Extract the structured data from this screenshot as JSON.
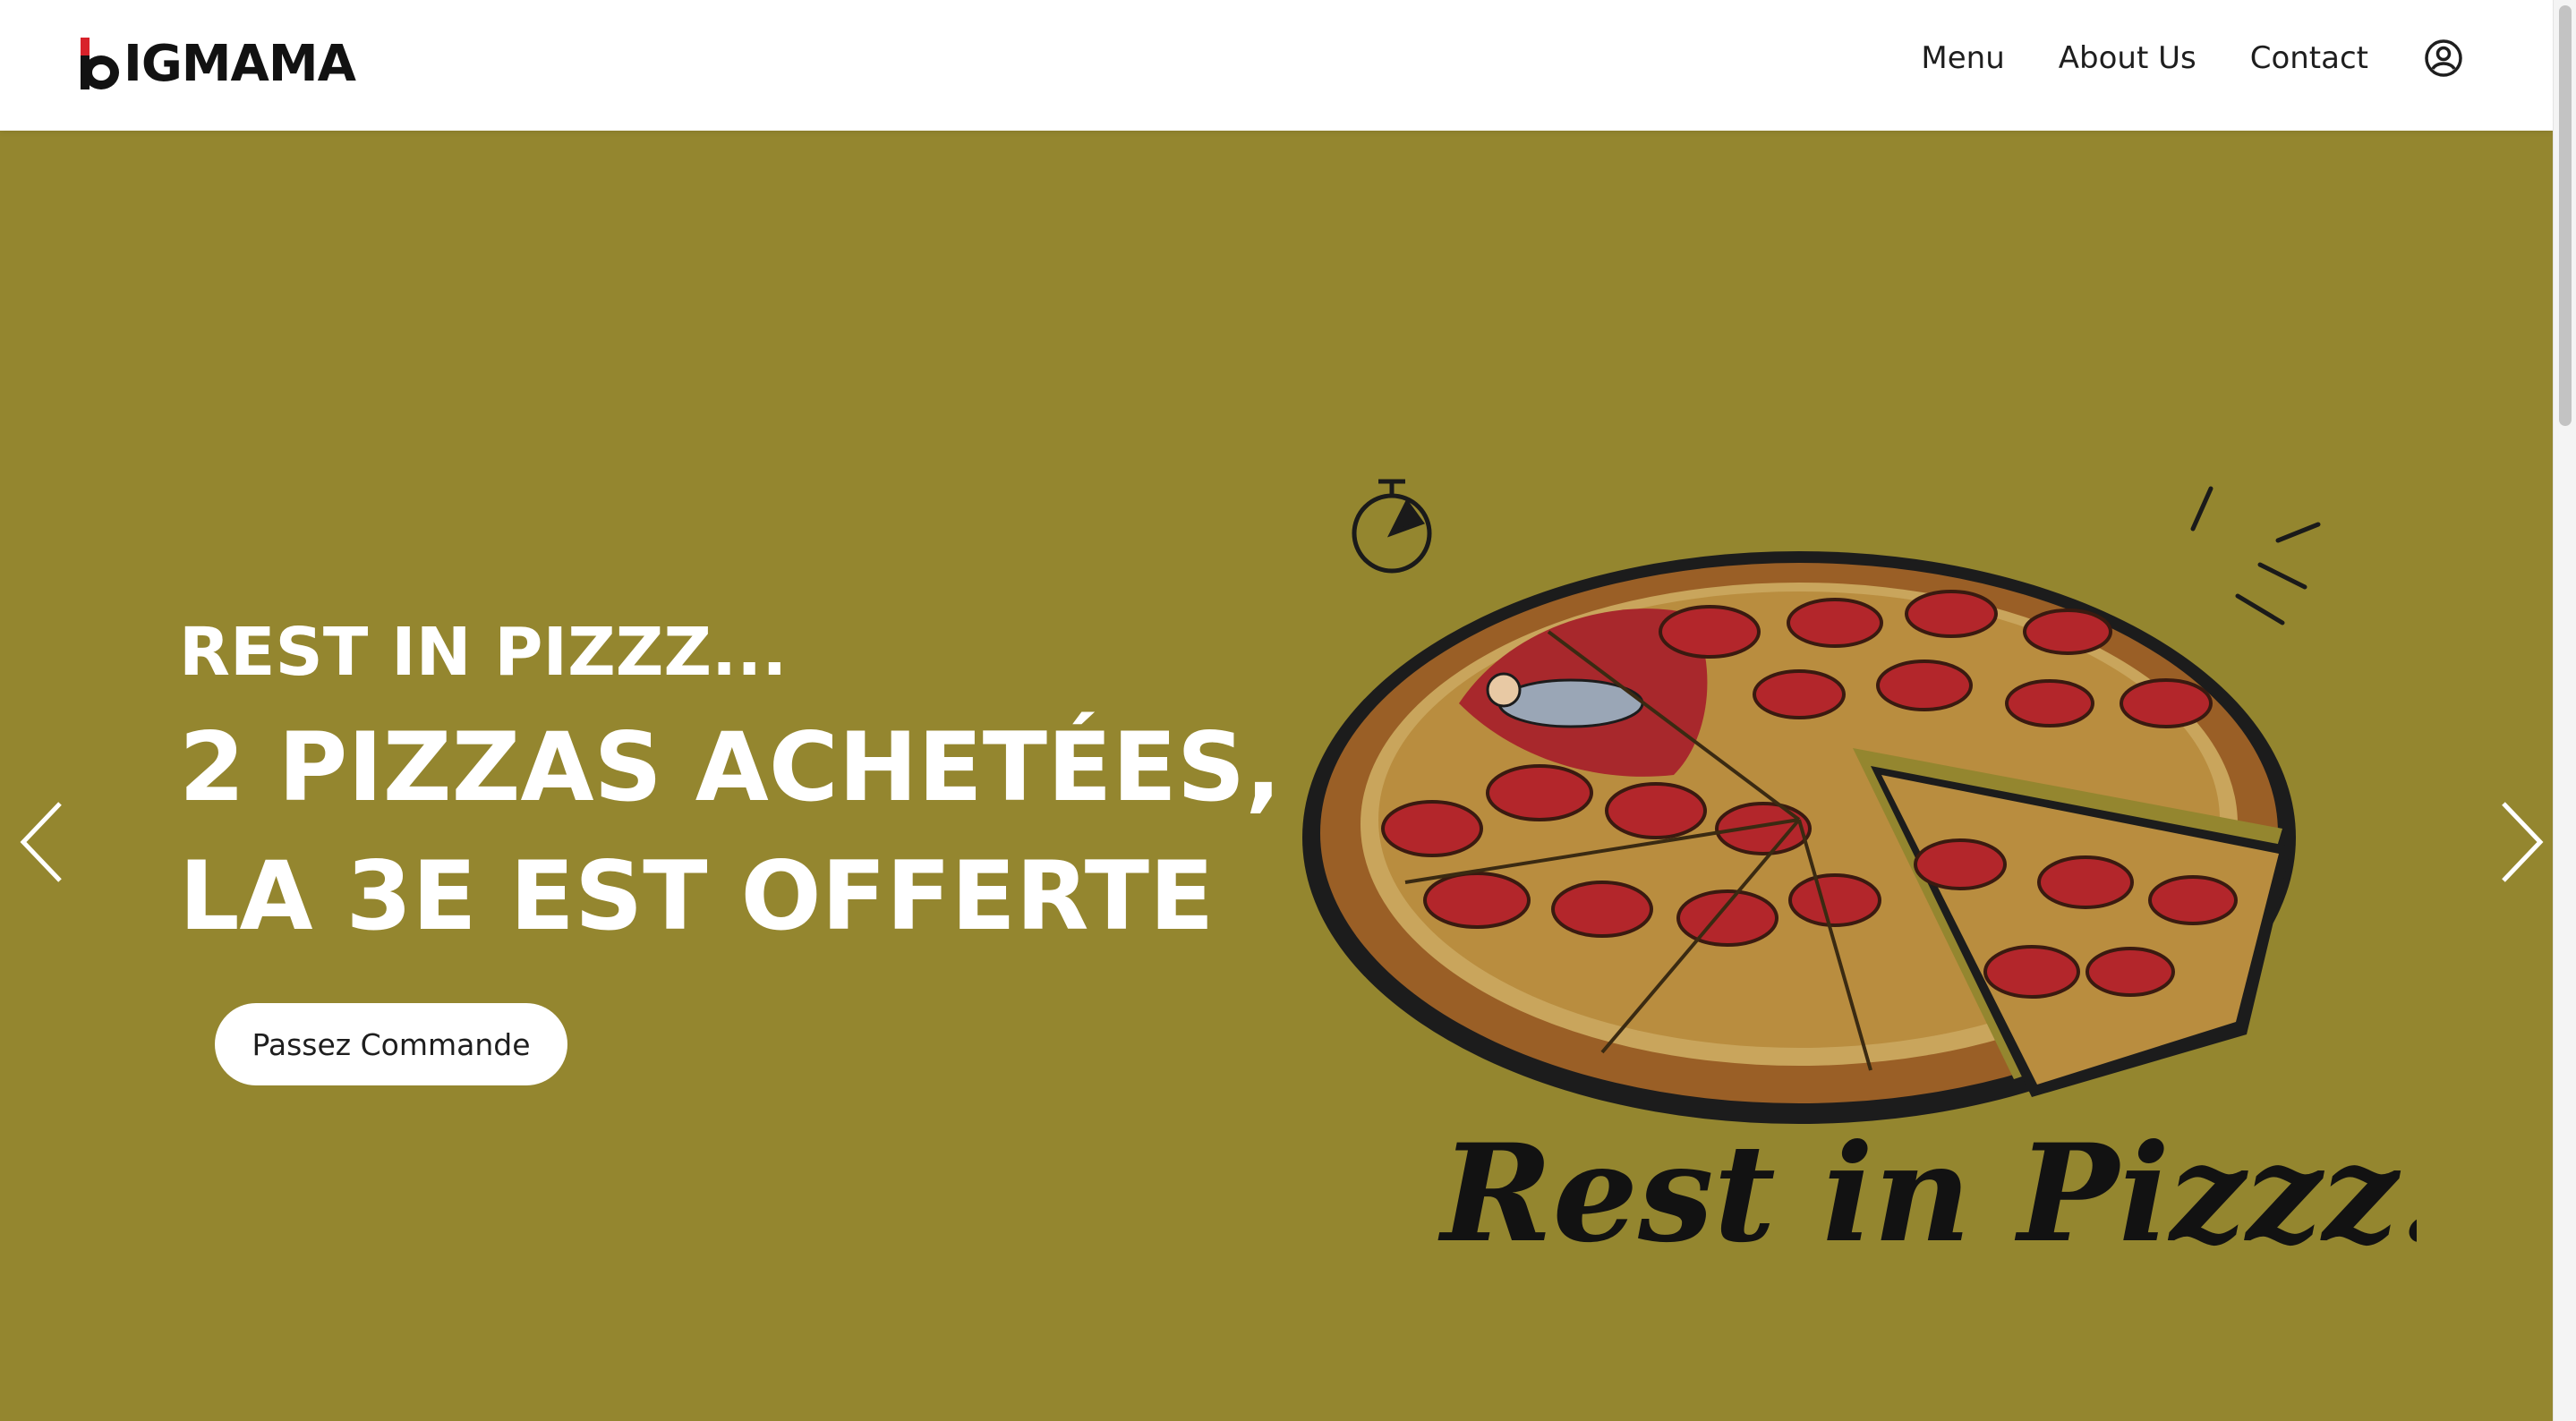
{
  "header": {
    "logo": "BIGMAMA",
    "nav": {
      "menu": "Menu",
      "about": "About Us",
      "contact": "Contact"
    }
  },
  "hero": {
    "kicker": "REST IN PIZZZ...",
    "headline_line1": "2 PIZZAS ACHETÉES,",
    "headline_line2": "LA 3E EST OFFERTE",
    "cta": "Passez Commande",
    "illustration_text": "Rest in Pizzz...",
    "background_color": "#94862f"
  },
  "icons": {
    "user": "user-circle-icon",
    "prev": "chevron-left-icon",
    "next": "chevron-right-icon"
  }
}
